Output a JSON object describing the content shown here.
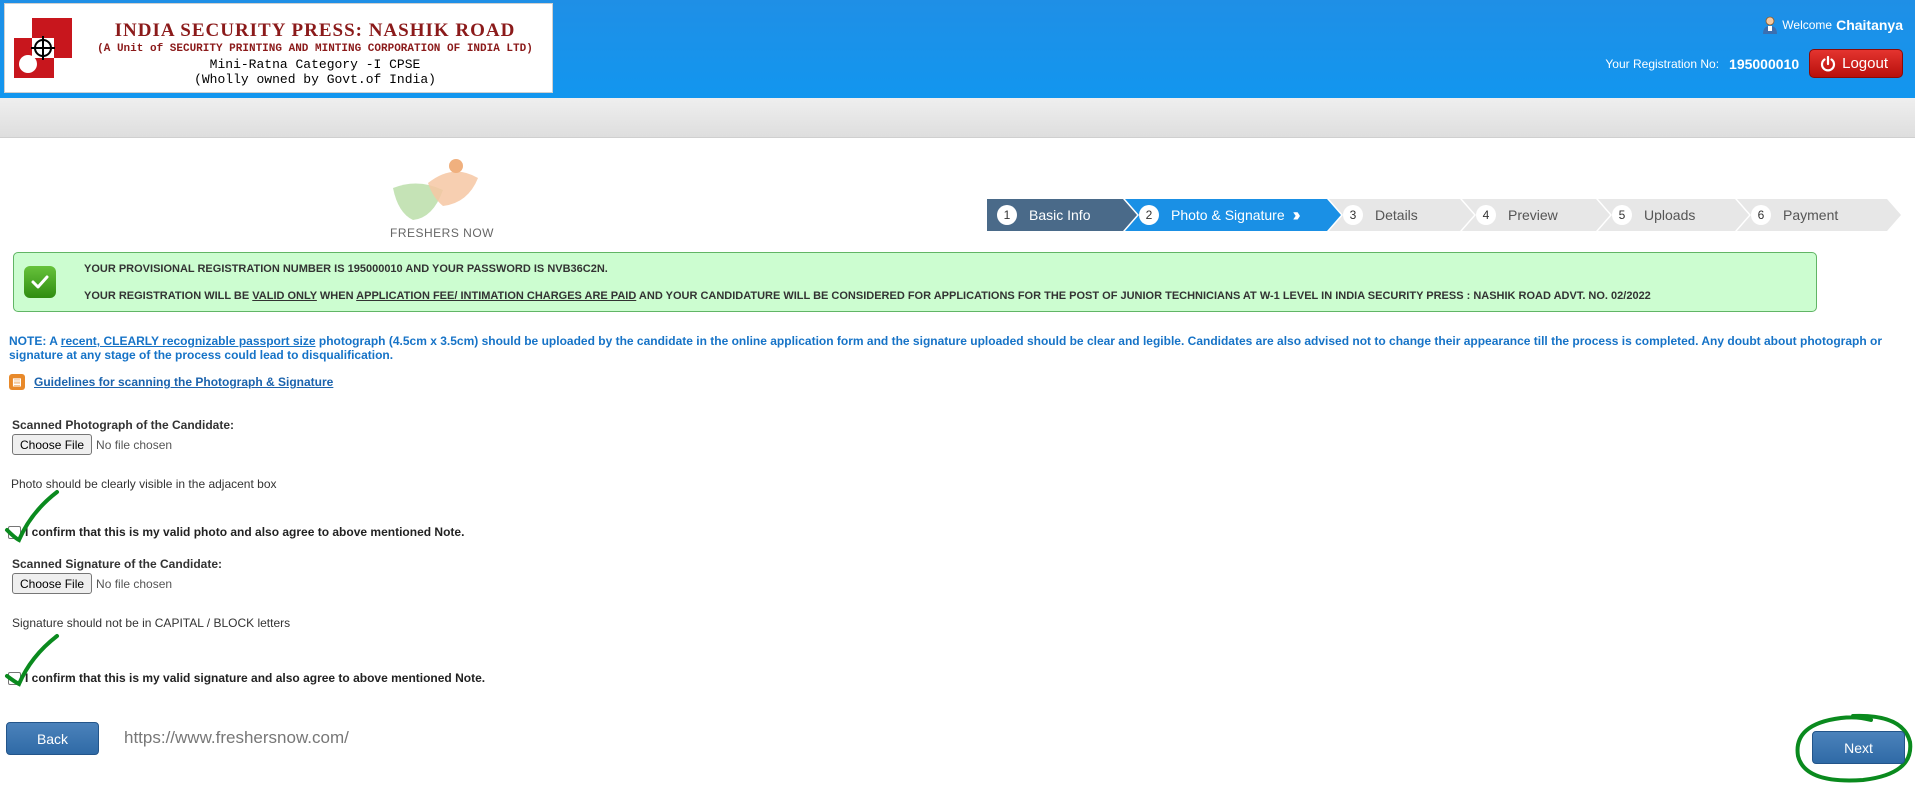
{
  "header": {
    "logo": {
      "line1": "INDIA SECURITY PRESS: NASHIK ROAD",
      "line2": "(A Unit of SECURITY PRINTING AND MINTING CORPORATION OF INDIA LTD)",
      "line3": "Mini-Ratna Category -I CPSE",
      "line4": "(Wholly owned by Govt.of India)"
    },
    "welcome_label": "Welcome",
    "user_name": "Chaitanya",
    "reg_label": "Your Registration No:",
    "reg_no": "195000010",
    "logout_label": "Logout"
  },
  "watermark": {
    "brand": "FRESHERS NOW",
    "url": "https://www.freshersnow.com/"
  },
  "wizard": {
    "steps": [
      {
        "num": "1",
        "label": "Basic Info"
      },
      {
        "num": "2",
        "label": "Photo & Signature"
      },
      {
        "num": "3",
        "label": "Details"
      },
      {
        "num": "4",
        "label": "Preview"
      },
      {
        "num": "5",
        "label": "Uploads"
      },
      {
        "num": "6",
        "label": "Payment"
      }
    ]
  },
  "alert": {
    "line1": "YOUR PROVISIONAL REGISTRATION NUMBER IS 195000010 AND YOUR PASSWORD IS NVB36C2N.",
    "line2_a": "YOUR REGISTRATION WILL BE ",
    "line2_b": "VALID ONLY",
    "line2_c": " WHEN ",
    "line2_d": "APPLICATION FEE/ INTIMATION CHARGES ARE PAID",
    "line2_e": " AND YOUR CANDIDATURE WILL BE CONSIDERED FOR APPLICATIONS FOR THE POST OF JUNIOR TECHNICIANS AT W-1 LEVEL IN INDIA SECURITY PRESS : NASHIK ROAD ADVT. NO. 02/2022"
  },
  "note": {
    "prefix": "NOTE: A ",
    "emph": "recent, CLEARLY recognizable passport size",
    "rest": " photograph (4.5cm x 3.5cm) should be uploaded by the candidate in the online application form and the signature uploaded should be clear and legible. Candidates are also advised not to change their appearance till the process is completed. Any doubt about photograph or signature at any stage of the process could lead to disqualification."
  },
  "guidelines_link": "Guidelines for scanning the Photograph & Signature",
  "photo": {
    "label": "Scanned Photograph of the Candidate:",
    "button": "Choose File",
    "status": "No file chosen",
    "hint": "Photo should be clearly visible in the adjacent box",
    "confirm": "I confirm that this is my valid photo and also agree to above mentioned Note."
  },
  "signature": {
    "label": "Scanned Signature of the Candidate:",
    "button": "Choose File",
    "status": "No file chosen",
    "hint": "Signature should not be in CAPITAL / BLOCK letters",
    "confirm": "I confirm that this is my valid signature and also agree to above mentioned Note."
  },
  "buttons": {
    "back": "Back",
    "next": "Next"
  }
}
